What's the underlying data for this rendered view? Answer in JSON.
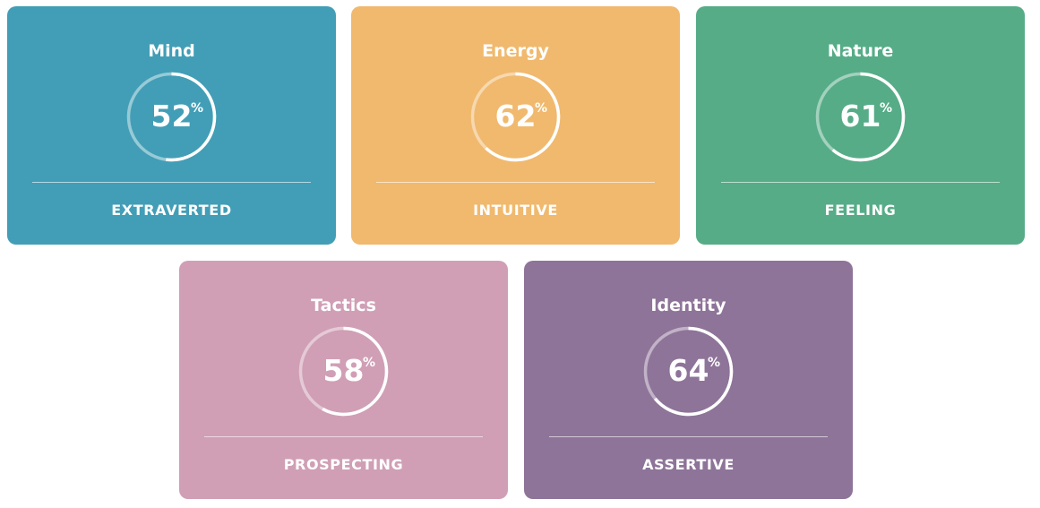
{
  "cards": [
    {
      "title": "Mind",
      "percent": 52,
      "percent_label": "52",
      "percent_sign": "%",
      "trait": "EXTRAVERTED",
      "color": "#429eb6"
    },
    {
      "title": "Energy",
      "percent": 62,
      "percent_label": "62",
      "percent_sign": "%",
      "trait": "INTUITIVE",
      "color": "#f0b96e"
    },
    {
      "title": "Nature",
      "percent": 61,
      "percent_label": "61",
      "percent_sign": "%",
      "trait": "FEELING",
      "color": "#56ac87"
    },
    {
      "title": "Tactics",
      "percent": 58,
      "percent_label": "58",
      "percent_sign": "%",
      "trait": "PROSPECTING",
      "color": "#d09fb5"
    },
    {
      "title": "Identity",
      "percent": 64,
      "percent_label": "64",
      "percent_sign": "%",
      "trait": "ASSERTIVE",
      "color": "#8e7499"
    }
  ]
}
